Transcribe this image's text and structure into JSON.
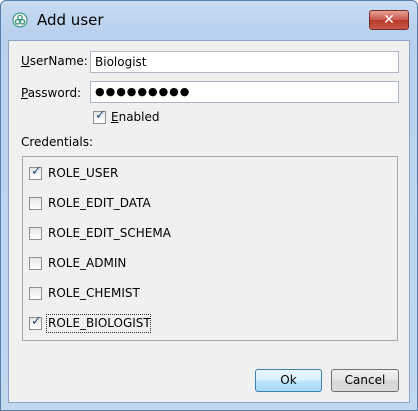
{
  "window": {
    "title": "Add user",
    "app_icon": "app-logo-icon",
    "close_glyph": "✕"
  },
  "form": {
    "username_label": "UserName:",
    "username_value": "Biologist",
    "password_label": "Password:",
    "password_value": "●●●●●●●●●",
    "enabled_label": "Enabled",
    "enabled_checked": true,
    "credentials_label": "Credentials:"
  },
  "credentials": [
    {
      "label": "ROLE_USER",
      "checked": true
    },
    {
      "label": "ROLE_EDIT_DATA",
      "checked": false
    },
    {
      "label": "ROLE_EDIT_SCHEMA",
      "checked": false
    },
    {
      "label": "ROLE_ADMIN",
      "checked": false
    },
    {
      "label": "ROLE_CHEMIST",
      "checked": false
    },
    {
      "label": "ROLE_BIOLOGIST",
      "checked": true
    }
  ],
  "buttons": {
    "ok_label": "Ok",
    "cancel_label": "Cancel"
  },
  "colors": {
    "title_bar": "#b9d1ee",
    "close_button": "#c9554a",
    "client_bg": "#f0f0f0",
    "check_mark": "#2a4b7c"
  }
}
